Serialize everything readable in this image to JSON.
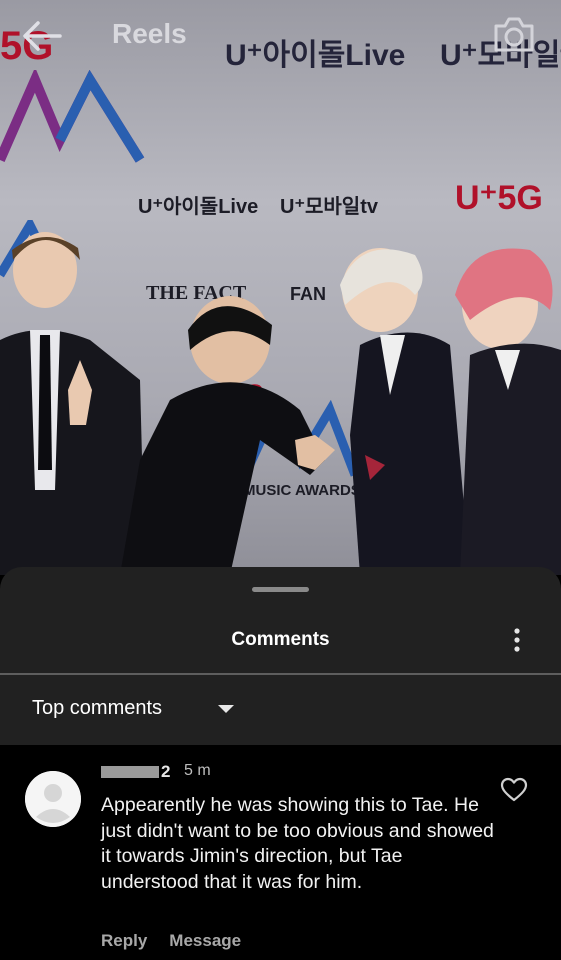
{
  "header": {
    "title": "Reels",
    "back_icon": "back-arrow-icon",
    "camera_icon": "camera-icon"
  },
  "video_backdrop": {
    "texts": [
      "U⁺아이돌Live",
      "U⁺모바일tv",
      "U⁺아이돌Live",
      "U⁺모바일tv",
      "U⁺5G",
      "THE FACT",
      "FAN",
      "MUSIC AWARDS",
      "5G"
    ]
  },
  "comments_sheet": {
    "title": "Comments",
    "menu_icon": "more-vertical-icon",
    "sort": {
      "label": "Top comments",
      "icon": "dropdown-caret-icon"
    },
    "comment": {
      "author_suffix": "2",
      "time": "5 m",
      "text": "Appearently he was showing this to Tae. He just didn't want to be too obvious and showed it towards Jimin's direction, but Tae understood that it was for him.",
      "reply_label": "Reply",
      "message_label": "Message",
      "like_icon": "heart-outline-icon"
    }
  },
  "colors": {
    "sheet_bg": "#212121",
    "comment_bg": "#000000",
    "accent_red": "#b0112a"
  }
}
